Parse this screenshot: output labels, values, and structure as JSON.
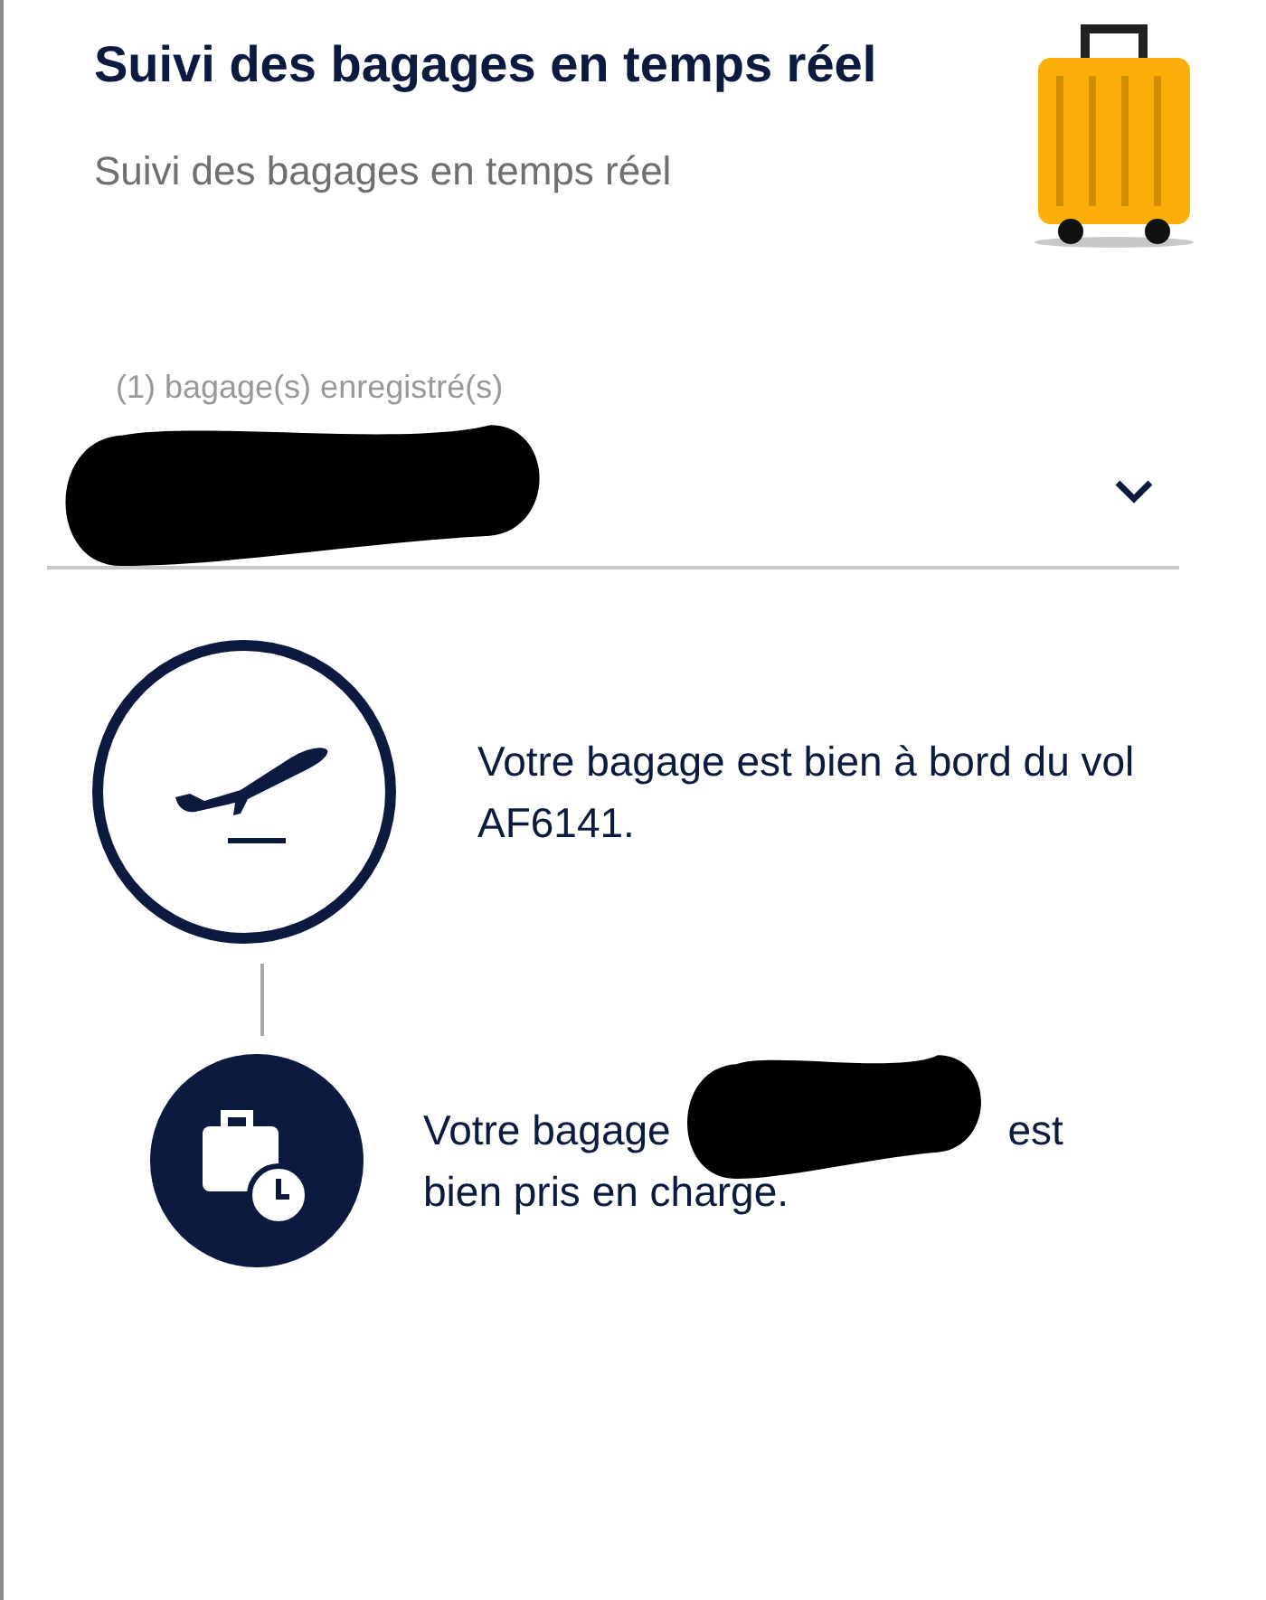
{
  "header": {
    "title": "Suivi des bagages en temps réel",
    "subtitle": "Suivi des bagages en temps réel"
  },
  "bag_select": {
    "label": "(1) bagage(s) enregistré(s)",
    "redacted": true
  },
  "steps": [
    {
      "kind": "boarded",
      "text_before": "Votre bagage est bien à bord du vol AF6141.",
      "redacted": false
    },
    {
      "kind": "checked",
      "text_before": "Votre bagage",
      "redacted": true,
      "text_after": "est bien pris en charge."
    }
  ]
}
